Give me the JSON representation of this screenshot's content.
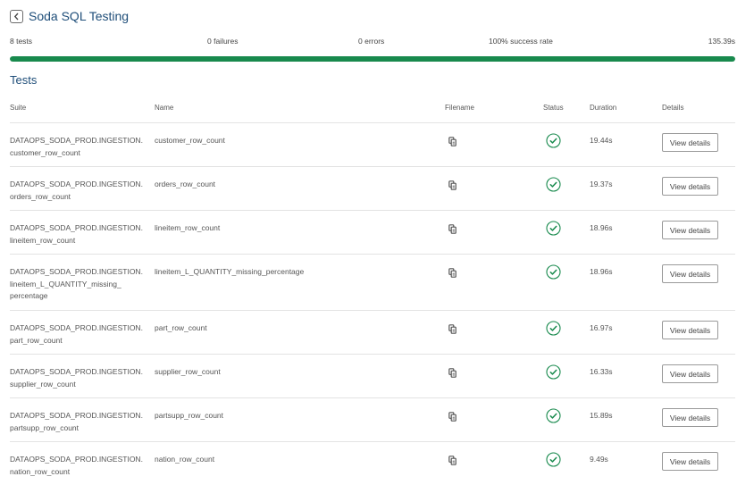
{
  "header": {
    "title": "Soda SQL Testing"
  },
  "stats": {
    "tests": "8 tests",
    "failures": "0 failures",
    "errors": "0 errors",
    "success": "100% success rate",
    "duration": "135.39s",
    "success_fraction": 1.0
  },
  "section_title": "Tests",
  "columns": {
    "suite": "Suite",
    "name": "Name",
    "filename": "Filename",
    "status": "Status",
    "duration": "Duration",
    "details": "Details"
  },
  "status_color": "#188a4d",
  "rows": [
    {
      "suite_1": "DATAOPS_SODA_PROD.INGESTION.",
      "suite_2": "customer_row_count",
      "suite_3": "",
      "name": "customer_row_count",
      "duration": "19.44s",
      "details": "View details",
      "status": "passed"
    },
    {
      "suite_1": "DATAOPS_SODA_PROD.INGESTION.",
      "suite_2": "orders_row_count",
      "suite_3": "",
      "name": "orders_row_count",
      "duration": "19.37s",
      "details": "View details",
      "status": "passed"
    },
    {
      "suite_1": "DATAOPS_SODA_PROD.INGESTION.",
      "suite_2": "lineitem_row_count",
      "suite_3": "",
      "name": "lineitem_row_count",
      "duration": "18.96s",
      "details": "View details",
      "status": "passed"
    },
    {
      "suite_1": "DATAOPS_SODA_PROD.INGESTION.",
      "suite_2": "lineitem_L_QUANTITY_missing_",
      "suite_3": "percentage",
      "name": "lineitem_L_QUANTITY_missing_percentage",
      "duration": "18.96s",
      "details": "View details",
      "status": "passed"
    },
    {
      "suite_1": "DATAOPS_SODA_PROD.INGESTION.",
      "suite_2": "part_row_count",
      "suite_3": "",
      "name": "part_row_count",
      "duration": "16.97s",
      "details": "View details",
      "status": "passed"
    },
    {
      "suite_1": "DATAOPS_SODA_PROD.INGESTION.",
      "suite_2": "supplier_row_count",
      "suite_3": "",
      "name": "supplier_row_count",
      "duration": "16.33s",
      "details": "View details",
      "status": "passed"
    },
    {
      "suite_1": "DATAOPS_SODA_PROD.INGESTION.",
      "suite_2": "partsupp_row_count",
      "suite_3": "",
      "name": "partsupp_row_count",
      "duration": "15.89s",
      "details": "View details",
      "status": "passed"
    },
    {
      "suite_1": "DATAOPS_SODA_PROD.INGESTION.",
      "suite_2": "nation_row_count",
      "suite_3": "",
      "name": "nation_row_count",
      "duration": "9.49s",
      "details": "View details",
      "status": "passed"
    }
  ]
}
